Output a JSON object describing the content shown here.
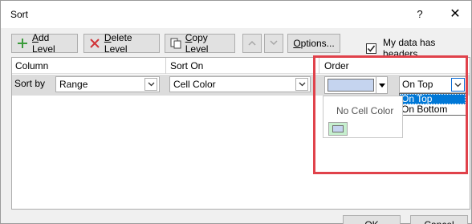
{
  "window": {
    "title": "Sort",
    "help_glyph": "?",
    "close_glyph": "✕"
  },
  "toolbar": {
    "add_level": {
      "accel": "A",
      "rest": "dd Level"
    },
    "delete_level": {
      "accel": "D",
      "rest": "elete Level"
    },
    "copy_level": {
      "accel": "C",
      "rest": "opy Level"
    },
    "options": {
      "accel": "O",
      "rest": "ptions..."
    }
  },
  "headers_checkbox": {
    "checked": true,
    "label_pre": "My data has ",
    "label_accel": "h",
    "label_post": "eaders"
  },
  "columns": {
    "column": "Column",
    "sort_on": "Sort On",
    "order": "Order"
  },
  "row": {
    "label": "Sort by",
    "column_value": "Range",
    "sort_on_value": "Cell Color",
    "color_value": "#c5d4ef",
    "order_value": "On Top"
  },
  "order_options": [
    "On Top",
    "On Bottom"
  ],
  "color_panel": {
    "no_color_label": "No Cell Color",
    "palette": [
      "#c5d4ef"
    ]
  },
  "footer": {
    "ok": "OK",
    "cancel": "Cancel"
  },
  "colors": {
    "highlight": "#e0424b",
    "selected": "#0078d7"
  }
}
